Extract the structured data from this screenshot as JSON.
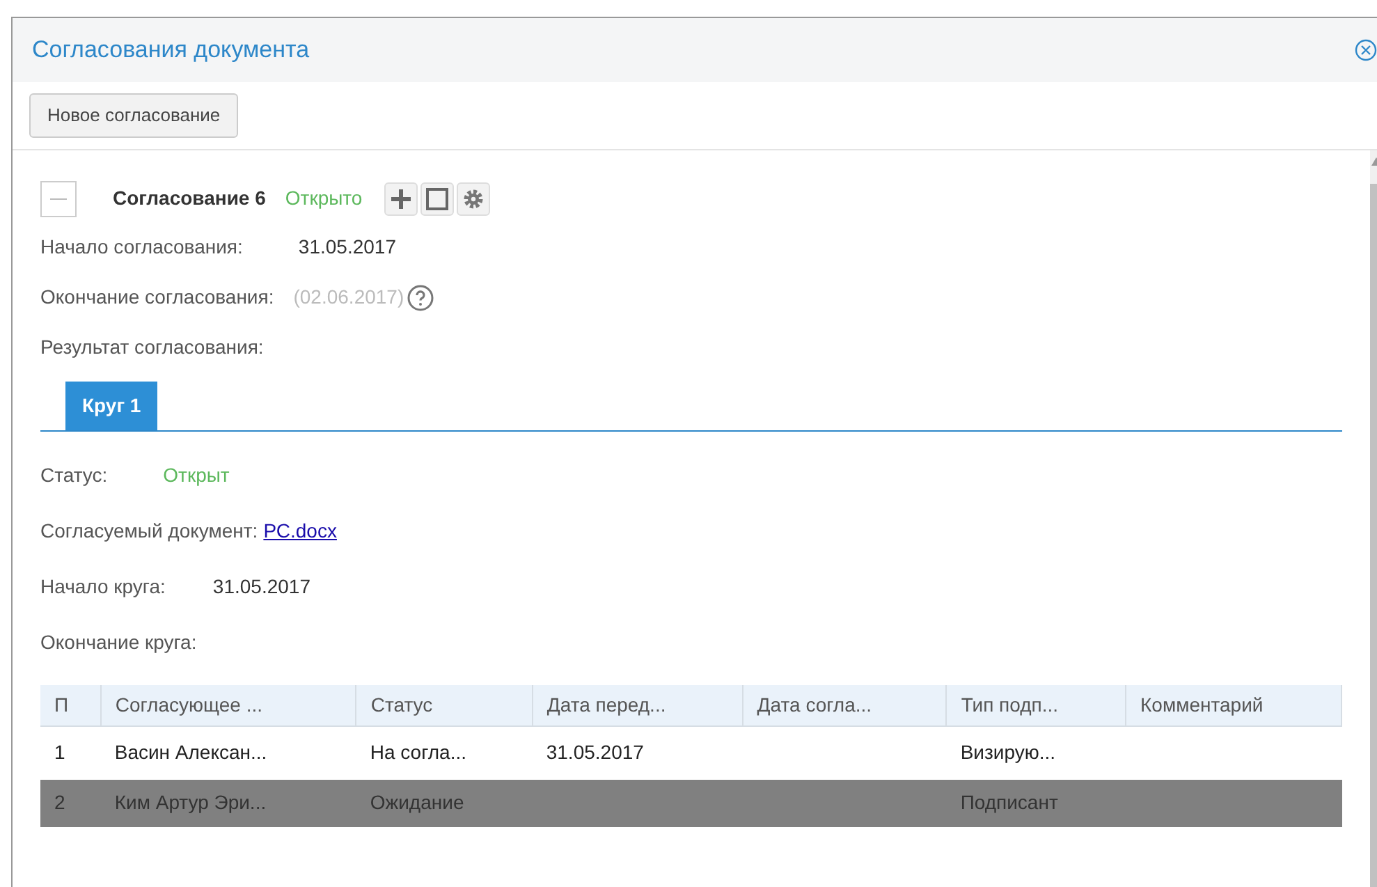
{
  "window": {
    "title": "Согласования документа"
  },
  "toolbar": {
    "button": "Новое согласование"
  },
  "approval": {
    "expanded": true,
    "title": "Согласование 6",
    "status": "Открыто",
    "fields": [
      {
        "label": "Начало согласования:",
        "value": "31.05.2017",
        "muted": false,
        "help": false
      },
      {
        "label": "Окончание согласования:",
        "value": "(02.06.2017)",
        "muted": true,
        "help": true
      },
      {
        "label": "Результат согласования:"
      }
    ]
  },
  "tabs": [
    {
      "label": "Круг 1",
      "selected": true
    }
  ],
  "round": {
    "fields": [
      {
        "label": "Статус:",
        "value": "Открыт",
        "kind": "status"
      },
      {
        "label": "Согласуемый документ:",
        "value": "РС.docx",
        "kind": "link"
      },
      {
        "label": "Начало круга:",
        "value": "31.05.2017",
        "kind": "text"
      },
      {
        "label": "Окончание круга:"
      }
    ]
  },
  "table": {
    "columns": [
      "П",
      "Согласующее ...",
      "Статус",
      "Дата перед...",
      "Дата согла...",
      "Тип подп...",
      "Комментарий"
    ],
    "rows": [
      {
        "cells": [
          "1",
          "Васин Алексан...",
          "На согла...",
          "31.05.2017",
          "",
          "Визирую...",
          ""
        ],
        "selected": false
      },
      {
        "cells": [
          "2",
          "Ким Артур Эри...",
          "Ожидание",
          "",
          "",
          "Подписант",
          ""
        ],
        "selected": true
      }
    ]
  }
}
